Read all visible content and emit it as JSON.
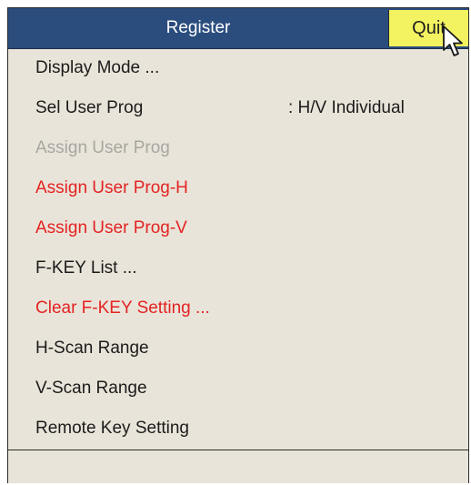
{
  "title_bar": {
    "title": "Register",
    "quit_label": "Quit"
  },
  "menu": {
    "items": [
      {
        "label": "Display Mode ...",
        "value": "",
        "state": "normal"
      },
      {
        "label": "Sel User Prog",
        "value": ": H/V Individual",
        "state": "normal"
      },
      {
        "label": "Assign User Prog",
        "value": "",
        "state": "disabled"
      },
      {
        "label": "Assign User Prog-H",
        "value": "",
        "state": "highlight"
      },
      {
        "label": "Assign User Prog-V",
        "value": "",
        "state": "highlight"
      },
      {
        "label": "F-KEY List ...",
        "value": "",
        "state": "normal"
      },
      {
        "label": "Clear F-KEY Setting ...",
        "value": "",
        "state": "highlight"
      },
      {
        "label": "H-Scan Range",
        "value": "",
        "state": "normal"
      },
      {
        "label": "V-Scan Range",
        "value": "",
        "state": "normal"
      },
      {
        "label": "Remote Key Setting",
        "value": "",
        "state": "normal"
      }
    ]
  },
  "colors": {
    "title_bar": "#2b4d7e",
    "quit_button": "#f3f260",
    "menu_background": "#e9e4d9",
    "highlight_text": "#e32323",
    "disabled_text": "#a8a6a1"
  },
  "icons": {
    "cursor": "mouse-pointer-icon"
  }
}
